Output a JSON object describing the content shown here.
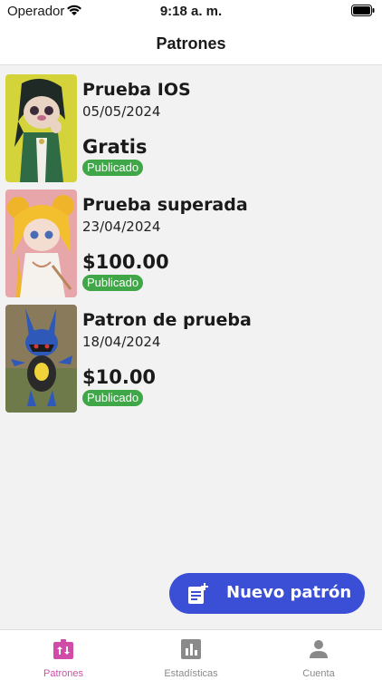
{
  "status_bar": {
    "carrier": "Operador",
    "time": "9:18 a. m."
  },
  "header": {
    "title": "Patrones"
  },
  "patterns": [
    {
      "name": "Prueba IOS",
      "date": "05/05/2024",
      "price": "Gratis",
      "status": "Publicado"
    },
    {
      "name": "Prueba superada",
      "date": "23/04/2024",
      "price": "$100.00",
      "status": "Publicado"
    },
    {
      "name": "Patron de prueba",
      "date": "18/04/2024",
      "price": "$10.00",
      "status": "Publicado"
    }
  ],
  "fab": {
    "label": "Nuevo patrón",
    "icon": "new-document-icon"
  },
  "tabs": [
    {
      "label": "Patrones",
      "icon": "patterns-icon",
      "active": true
    },
    {
      "label": "Estadísticas",
      "icon": "bar-chart-icon",
      "active": false
    },
    {
      "label": "Cuenta",
      "icon": "person-icon",
      "active": false
    }
  ],
  "colors": {
    "accent": "#d14ca9",
    "fab": "#3b4fd6",
    "badge": "#3fa747"
  }
}
